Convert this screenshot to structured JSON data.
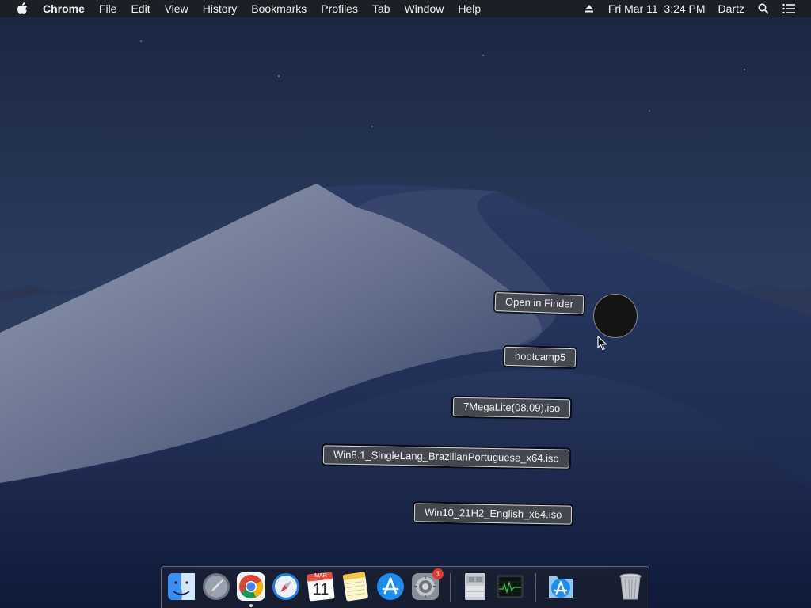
{
  "menubar": {
    "apple_icon": "apple-icon",
    "app_name": "Chrome",
    "menus": [
      "File",
      "Edit",
      "View",
      "History",
      "Bookmarks",
      "Profiles",
      "Tab",
      "Window",
      "Help"
    ],
    "eject_icon": "eject-icon",
    "datetime": "Fri Mar 11  3:24 PM",
    "user": "Dartz",
    "search_icon": "spotlight-search-icon",
    "list_icon": "notification-center-icon"
  },
  "desktop": {
    "action_label": "Open in Finder",
    "files": [
      "bootcamp5",
      "7MegaLite(08.09).iso",
      "Win8.1_SingleLang_BrazilianPortuguese_x64.iso",
      "Win10_21H2_English_x64.iso"
    ]
  },
  "dock": {
    "items": [
      {
        "name": "Finder",
        "icon": "finder-icon"
      },
      {
        "name": "Launchpad",
        "icon": "launchpad-icon"
      },
      {
        "name": "Google Chrome",
        "icon": "chrome-icon"
      },
      {
        "name": "Safari",
        "icon": "safari-icon"
      },
      {
        "name": "Calendar",
        "icon": "calendar-icon",
        "month": "MAR",
        "day": "11"
      },
      {
        "name": "Notes",
        "icon": "notes-icon"
      },
      {
        "name": "App Store",
        "icon": "app-store-icon"
      },
      {
        "name": "System Preferences",
        "icon": "system-preferences-icon",
        "badge": "1"
      },
      {
        "name": "Boot Camp Assistant",
        "icon": "boot-camp-icon"
      },
      {
        "name": "Activity Monitor",
        "icon": "activity-monitor-icon"
      },
      {
        "name": "Downloads",
        "icon": "downloads-folder-icon"
      },
      {
        "name": "Trash",
        "icon": "trash-icon"
      }
    ]
  },
  "colors": {
    "sky": "#1d2a44",
    "dune_light": "#8d96ad",
    "dune_shadow": "#20305a",
    "menubar": "#1c1e24",
    "badge": "#e0392b"
  }
}
